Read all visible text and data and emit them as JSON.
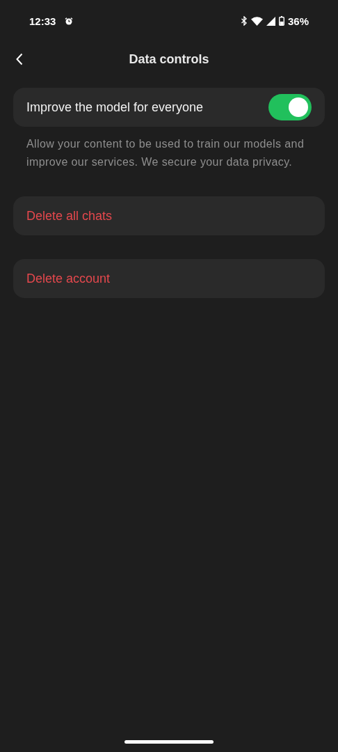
{
  "status_bar": {
    "time": "12:33",
    "battery": "36%"
  },
  "header": {
    "title": "Data controls"
  },
  "improve_setting": {
    "label": "Improve the model for everyone",
    "on": true,
    "description": "Allow your content to be used to train our models and improve our services. We secure your data privacy."
  },
  "actions": [
    {
      "label": "Delete all chats"
    },
    {
      "label": "Delete account"
    }
  ]
}
